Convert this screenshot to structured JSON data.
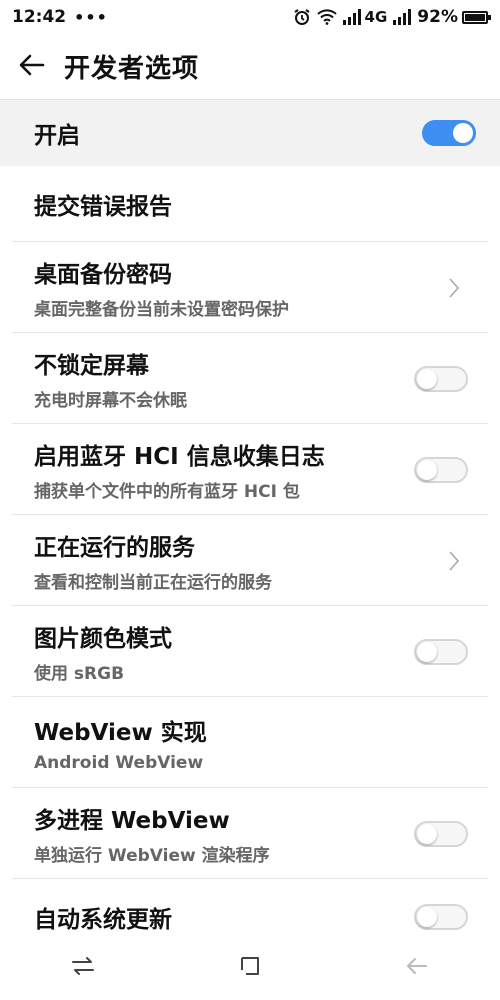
{
  "status_bar": {
    "time": "12:42",
    "dots": "•••",
    "network": "4G",
    "battery": "92%",
    "battery_level": 0.92,
    "icons": [
      "alarm-icon",
      "wifi-icon",
      "cell-signal-icon",
      "cell-signal-icon",
      "battery-icon"
    ]
  },
  "header": {
    "title": "开发者选项",
    "back_icon": "back-arrow-icon"
  },
  "master": {
    "label": "开启",
    "on": true,
    "accent": "#3f8ef2"
  },
  "items": [
    {
      "title": "提交错误报告",
      "subtitle": "",
      "control": "none"
    },
    {
      "title": "桌面备份密码",
      "subtitle": "桌面完整备份当前未设置密码保护",
      "control": "chevron"
    },
    {
      "title": "不锁定屏幕",
      "subtitle": "充电时屏幕不会休眠",
      "control": "toggle",
      "on": false
    },
    {
      "title": "启用蓝牙 HCI 信息收集日志",
      "subtitle": "捕获单个文件中的所有蓝牙 HCI 包",
      "control": "toggle",
      "on": false
    },
    {
      "title": "正在运行的服务",
      "subtitle": "查看和控制当前正在运行的服务",
      "control": "chevron"
    },
    {
      "title": "图片颜色模式",
      "subtitle": "使用 sRGB",
      "control": "toggle",
      "on": false
    },
    {
      "title": "WebView 实现",
      "subtitle": "Android WebView",
      "control": "none"
    },
    {
      "title": "多进程 WebView",
      "subtitle": "单独运行 WebView 渲染程序",
      "control": "toggle",
      "on": false
    },
    {
      "title": "自动系统更新",
      "subtitle": "",
      "control": "toggle",
      "on": false
    }
  ],
  "nav": {
    "icons": [
      "switch-icon",
      "home-square-icon",
      "back-icon"
    ]
  }
}
